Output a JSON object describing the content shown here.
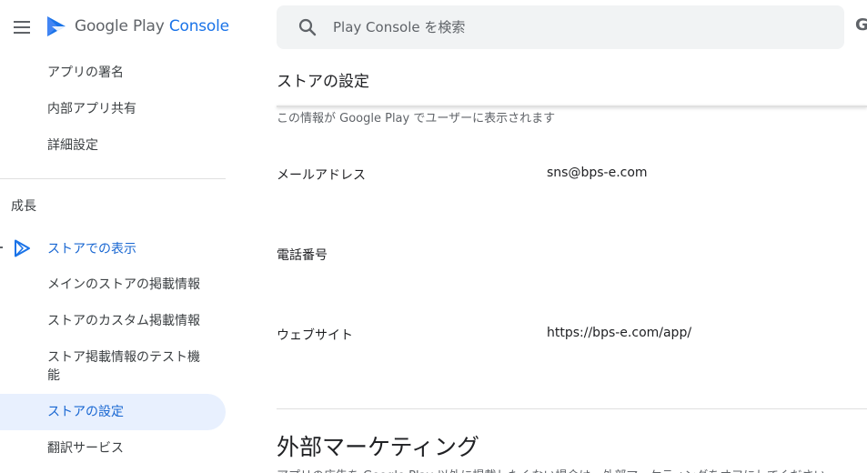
{
  "header": {
    "brand_google_play": "Google Play",
    "brand_console": "Console",
    "top_right_glyph": "G"
  },
  "search": {
    "placeholder": "Play Console を検索"
  },
  "sidebar": {
    "items_top": [
      {
        "label": "アプリの署名"
      },
      {
        "label": "内部アプリ共有"
      },
      {
        "label": "詳細設定"
      }
    ],
    "section_label": "成長",
    "group": {
      "label": "ストアでの表示"
    },
    "items_sub": [
      {
        "label": "メインのストアの掲載情報"
      },
      {
        "label": "ストアのカスタム掲載情報"
      },
      {
        "label": "ストア掲載情報のテスト機能"
      },
      {
        "label": "ストアの設定"
      },
      {
        "label": "翻訳サービス"
      }
    ]
  },
  "main": {
    "title": "ストアの設定",
    "subtitle": "この情報が Google Play でユーザーに表示されます",
    "rows": [
      {
        "label": "メールアドレス",
        "value": "sns@bps-e.com"
      },
      {
        "label": "電話番号",
        "value": ""
      },
      {
        "label": "ウェブサイト",
        "value": "https://bps-e.com/app/"
      }
    ],
    "section_title": "外部マーケティング",
    "section_cut_text": "アプリの広告を Google Play 以外に掲載したくない場合は、外部マーケティングをオフにしてください"
  },
  "colors": {
    "accent": "#1a73e8",
    "active_bg": "#e8f0fe",
    "search_bg": "#f1f3f4"
  }
}
